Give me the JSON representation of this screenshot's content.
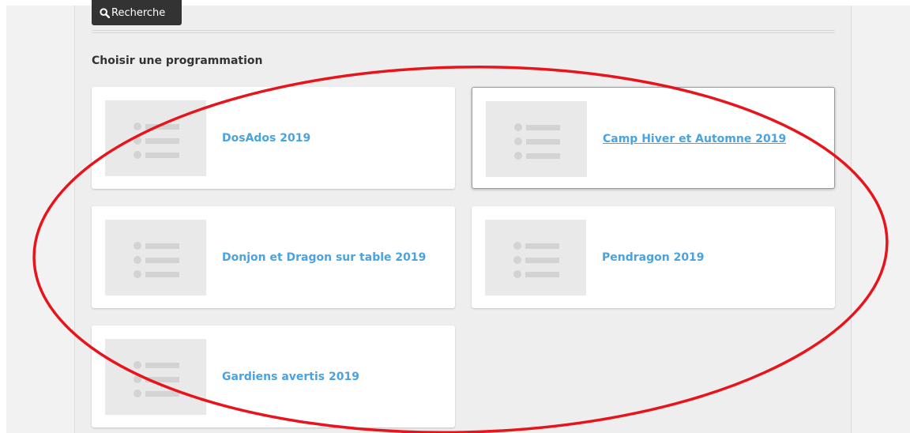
{
  "toolbar": {
    "search_label": "Recherche"
  },
  "section": {
    "title": "Choisir une programmation"
  },
  "programs": [
    {
      "title": "DosAdos 2019"
    },
    {
      "title": "Camp Hiver et Automne 2019"
    },
    {
      "title": "Donjon et Dragon sur table 2019"
    },
    {
      "title": "Pendragon 2019"
    },
    {
      "title": "Gardiens avertis 2019"
    }
  ],
  "icons": {
    "search": "search-icon",
    "placeholder": "list-placeholder-icon"
  },
  "colors": {
    "link": "#4aa3df",
    "button_bg": "#333333",
    "annotation": "#e8141c"
  }
}
